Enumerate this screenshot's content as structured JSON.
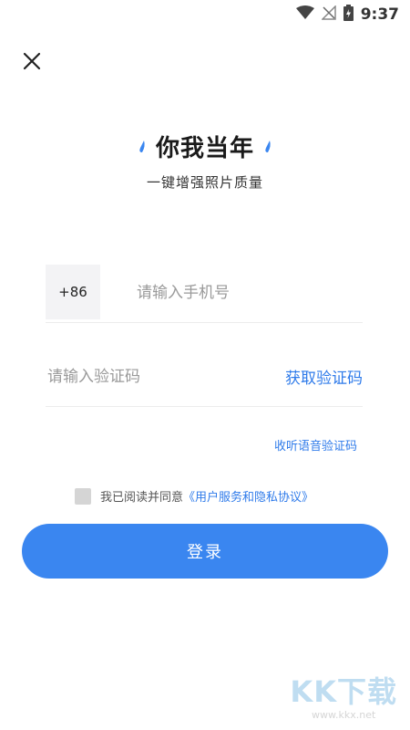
{
  "status_bar": {
    "time": "9:37",
    "icons": [
      "wifi-icon",
      "no-signal-icon",
      "battery-charging-icon"
    ]
  },
  "close": {
    "icon": "close-icon"
  },
  "header": {
    "title": "你我当年",
    "subtitle": "一键增强照片质量",
    "accent_color": "#3a86f0"
  },
  "phone": {
    "country_code": "+86",
    "placeholder": "请输入手机号"
  },
  "code": {
    "placeholder": "请输入验证码",
    "get_code_label": "获取验证码"
  },
  "voice_code_label": "收听语音验证码",
  "agreement": {
    "checked": false,
    "prefix": "我已阅读并同意",
    "link": "《用户服务和隐私协议》"
  },
  "login_label": "登录",
  "watermark": {
    "title": "KK下载",
    "url": "www.kkx.net"
  }
}
